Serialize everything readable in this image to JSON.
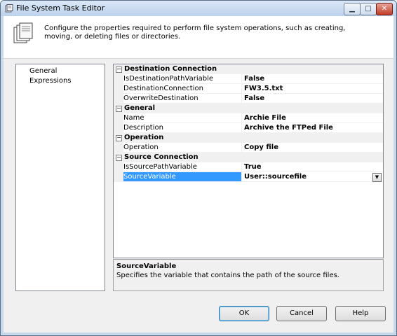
{
  "window": {
    "title": "File System Task Editor",
    "icon": "file-system-task-icon",
    "controls": {
      "minimize": "minimize-icon",
      "maximize": "maximize-icon",
      "close": "close-icon"
    }
  },
  "header": {
    "icon": "files-stack-icon",
    "description": "Configure the properties required to perform file system operations, such as creating, moving, or deleting files or directories."
  },
  "nav": {
    "items": [
      {
        "label": "General",
        "selected": true
      },
      {
        "label": "Expressions",
        "selected": false
      }
    ]
  },
  "grid": {
    "categories": [
      {
        "label": "Destination Connection",
        "properties": [
          {
            "name": "IsDestinationPathVariable",
            "value": "False"
          },
          {
            "name": "DestinationConnection",
            "value": "FW3.5.txt"
          },
          {
            "name": "OverwriteDestination",
            "value": "False"
          }
        ]
      },
      {
        "label": "General",
        "properties": [
          {
            "name": "Name",
            "value": "Archie File"
          },
          {
            "name": "Description",
            "value": "Archive the FTPed File"
          }
        ]
      },
      {
        "label": "Operation",
        "properties": [
          {
            "name": "Operation",
            "value": "Copy file"
          }
        ]
      },
      {
        "label": "Source Connection",
        "properties": [
          {
            "name": "IsSourcePathVariable",
            "value": "True"
          },
          {
            "name": "SourceVariable",
            "value": "User::sourcefile",
            "selected": true
          }
        ]
      }
    ],
    "collapse_glyph": "⊟"
  },
  "description_panel": {
    "title": "SourceVariable",
    "text": "Specifies the variable that contains the path of the source files."
  },
  "buttons": {
    "ok": "OK",
    "cancel": "Cancel",
    "help": "Help"
  },
  "colors": {
    "selection": "#3399ff",
    "category_bg": "#f0f0f0"
  }
}
